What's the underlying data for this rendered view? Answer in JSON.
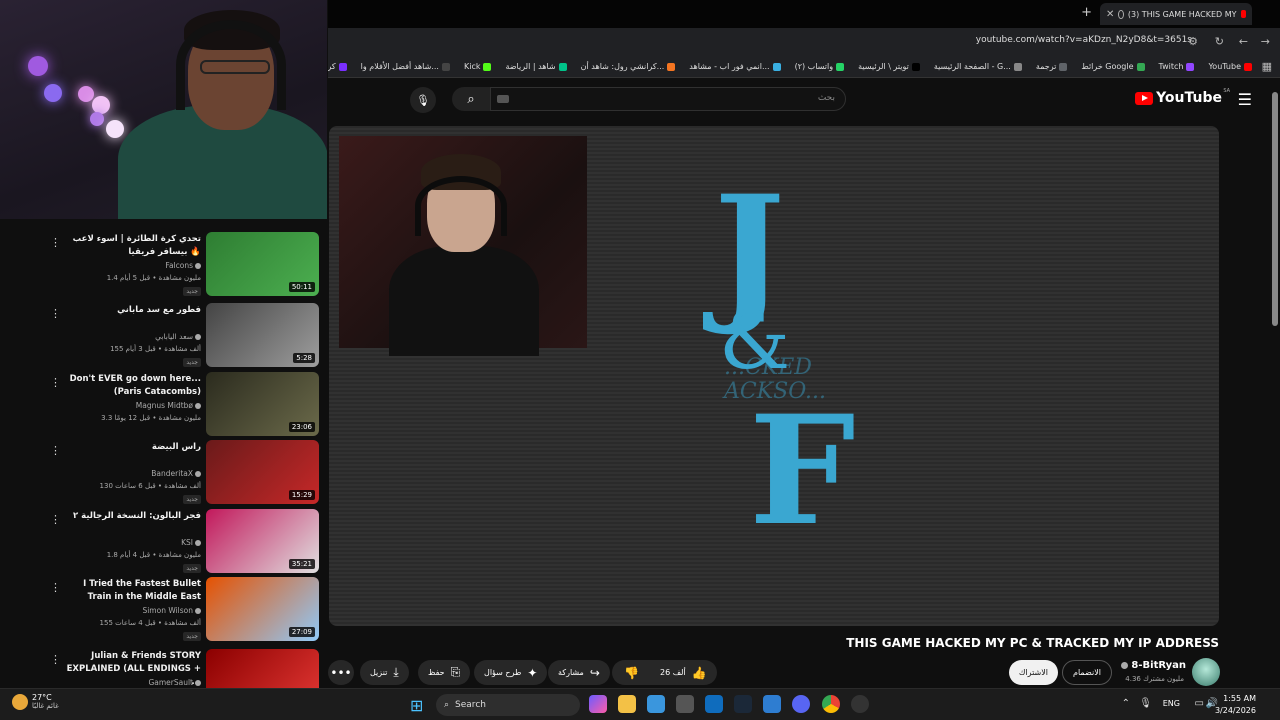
{
  "browser": {
    "tab_title": "(3) THIS GAME HACKED MY",
    "url": "youtube.com/watch?v=aKDzn_N2yD8&t=3651s",
    "bookmarks": [
      {
        "label": "YouTube",
        "color": "#ff0000"
      },
      {
        "label": "Twitch",
        "color": "#9146ff"
      },
      {
        "label": "خرائط Google",
        "color": "#34a853"
      },
      {
        "label": "ترجمة",
        "color": "#5f6368"
      },
      {
        "label": "الصفحة الرئيسية - G...",
        "color": "#888888"
      },
      {
        "label": "تويتر \\ الرئيسية",
        "color": "#000000"
      },
      {
        "label": "واتساب (٢)",
        "color": "#25d366"
      },
      {
        "label": "انمي فور اب - مشاهد...",
        "color": "#3ab0e2"
      },
      {
        "label": "كرانشي رول: شاهد أن...",
        "color": "#f47521"
      },
      {
        "label": "شاهد | الرياضة",
        "color": "#00c389"
      },
      {
        "label": "Kick",
        "color": "#53fc18"
      },
      {
        "label": "شاهد أفضل الأفلام وا...",
        "color": "#444444"
      },
      {
        "label": "كرتو",
        "color": "#7a2fff"
      }
    ]
  },
  "youtube": {
    "logo_text": "YouTube",
    "region": "SA",
    "search_placeholder": "بحث",
    "video_title": "THIS GAME HACKED MY PC & TRACKED MY IP ADDRESS",
    "channel_name": "8-BitRyan",
    "channel_subs": "4.36 مليون مشترك",
    "subscribe_label": "الاشتراك",
    "join_label": "الانضمام",
    "likes": "26 ألف",
    "share_label": "مشاركة",
    "ask_label": "طرح سؤال",
    "save_label": "حفظ",
    "download_label": "تنزيل",
    "logo_overlay_text": "...CKED\nACKSO..."
  },
  "recommendations": [
    {
      "title": "تحدي كرة الطائرة | اسوء لاعب بيسافر فريقيا 🔥",
      "channel": "Falcons",
      "meta": "1.4 مليون مشاهدة • قبل 5 أيام",
      "badge": "جديد",
      "duration": "50:11",
      "colors": [
        "#2e7d32",
        "#4caf50"
      ]
    },
    {
      "title": "فطور مع سد ماباني",
      "channel": "سعد اليابابي",
      "meta": "155 ألف مشاهدة • قبل 3 أيام",
      "badge": "جديد",
      "duration": "5:28",
      "colors": [
        "#444444",
        "#9e9e9e"
      ]
    },
    {
      "title": "Don't EVER go down here... (Paris Catacombs)",
      "channel": "Magnus Midtbø",
      "meta": "3.3 مليون مشاهدة • قبل 12 يومًا",
      "badge": "",
      "duration": "23:06",
      "colors": [
        "#2b2b1e",
        "#6b6a4a"
      ]
    },
    {
      "title": "راس البيضة",
      "channel": "BanderitaX",
      "meta": "130 ألف مشاهدة • قبل 6 ساعات",
      "badge": "جديد",
      "duration": "15:29",
      "colors": [
        "#6a1a1a",
        "#c62828"
      ]
    },
    {
      "title": "فجر البالون: النسخة الرجالية ٢",
      "channel": "KSI",
      "meta": "1.8 مليون مشاهدة • قبل 4 أيام",
      "badge": "جديد",
      "duration": "35:21",
      "colors": [
        "#c2185b",
        "#e0e0e0"
      ]
    },
    {
      "title": "I Tried the Fastest Bullet Train in the Middle East",
      "channel": "Simon Wilson",
      "meta": "155 ألف مشاهدة • قبل 4 ساعات",
      "badge": "جديد",
      "duration": "27:09",
      "colors": [
        "#e65100",
        "#90caf9"
      ]
    },
    {
      "title": "Julian & Friends STORY EXPLAINED (ALL ENDINGS + ...",
      "channel": "GamerSault",
      "meta": "",
      "badge": "",
      "duration": "",
      "colors": [
        "#8b0000",
        "#e53935"
      ]
    }
  ],
  "taskbar": {
    "temp": "27°C",
    "weather_desc": "غائم غالبًا",
    "search_label": "Search",
    "lang": "ENG",
    "time": "1:55 AM",
    "date": "3/24/2026"
  },
  "icons": [
    "search-icon",
    "mic-icon",
    "menu-icon",
    "like-icon",
    "dislike-icon",
    "share-icon",
    "download-icon",
    "save-icon",
    "more-icon"
  ]
}
